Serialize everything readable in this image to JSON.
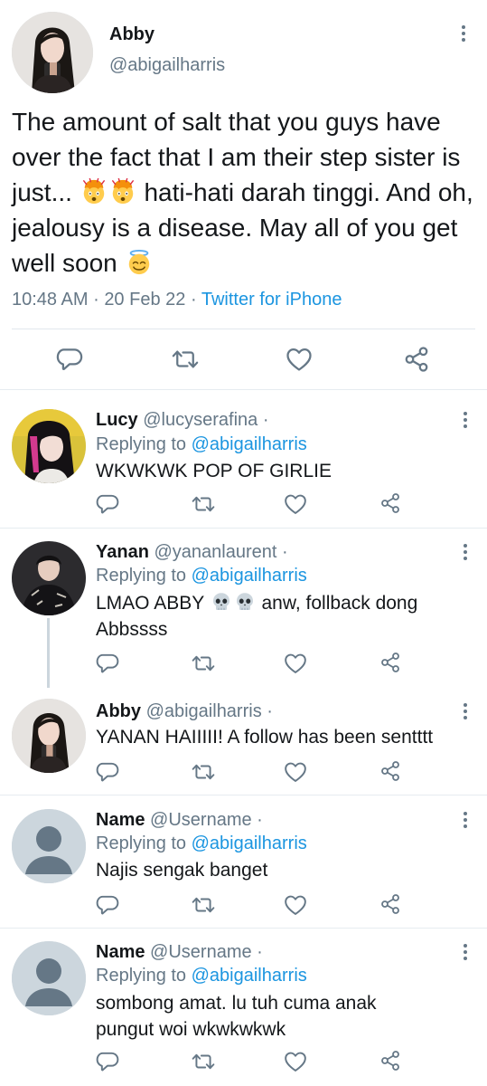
{
  "main": {
    "name": "Abby",
    "handle": "@abigailharris",
    "text_parts": [
      "The amount of salt that you guys have over the fact that I am their step sister is just... ",
      " hati-hati darah tinggi. And oh, jealousy is a disease. May all of you get well soon "
    ],
    "emojis": [
      "exploding-head",
      "exploding-head",
      "smiling-face-with-halo"
    ],
    "time": "10:48 AM",
    "date": "20 Feb 22",
    "source": "Twitter for iPhone",
    "sep": "·"
  },
  "replies": [
    {
      "name": "Lucy",
      "handle": "@lucyserafina",
      "dot": "·",
      "replying_label": "Replying to",
      "replying_to": "@abigailharris",
      "text": "WKWKWK POP OF GIRLIE",
      "avatar": "photo-lucy"
    },
    {
      "name": "Yanan",
      "handle": "@yananlaurent",
      "dot": "·",
      "replying_label": "Replying to",
      "replying_to": "@abigailharris",
      "text_before": "LMAO ABBY ",
      "text_after": " anw, follback dong Abbssss",
      "emojis": [
        "skull",
        "skull"
      ],
      "avatar": "photo-yanan"
    },
    {
      "name": "Abby",
      "handle": "@abigailharris",
      "dot": "·",
      "text": "YANAN HAIIIII! A follow has been sentttt",
      "avatar": "photo-abby"
    },
    {
      "name": "Name",
      "handle": "@Username",
      "dot": "·",
      "replying_label": "Replying to",
      "replying_to": "@abigailharris",
      "text": "Najis sengak banget",
      "avatar": "default-avatar"
    },
    {
      "name": "Name",
      "handle": "@Username",
      "dot": "·",
      "replying_label": "Replying to",
      "replying_to": "@abigailharris",
      "text": "sombong amat. lu tuh cuma anak pungut woi wkwkwkwk",
      "avatar": "default-avatar"
    }
  ],
  "icons": {
    "reply": "reply-icon",
    "retweet": "retweet-icon",
    "like": "like-icon",
    "share": "share-icon",
    "more": "more-vertical-icon"
  },
  "colors": {
    "text": "#14171a",
    "secondary": "#657786",
    "link": "#1b95e0",
    "divider": "#e1e8ed"
  }
}
